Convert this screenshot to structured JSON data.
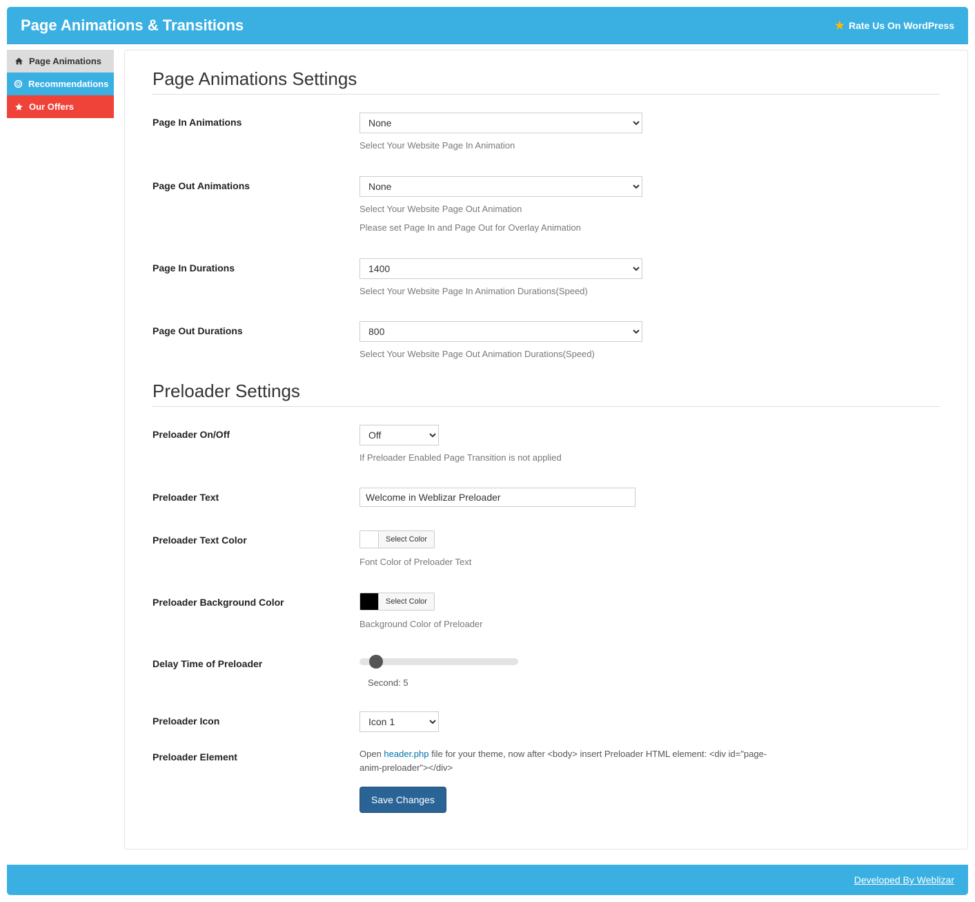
{
  "header": {
    "title": "Page Animations & Transitions",
    "rate_us": "Rate Us On WordPress"
  },
  "sidebar": {
    "items": [
      {
        "label": "Page Animations"
      },
      {
        "label": "Recommendations"
      },
      {
        "label": "Our Offers"
      }
    ]
  },
  "sections": {
    "page_anim_title": "Page Animations Settings",
    "preloader_title": "Preloader Settings"
  },
  "fields": {
    "page_in_anim": {
      "label": "Page In Animations",
      "value": "None",
      "help": "Select Your Website Page In Animation"
    },
    "page_out_anim": {
      "label": "Page Out Animations",
      "value": "None",
      "help": "Select Your Website Page Out Animation",
      "help2": "Please set Page In and Page Out for Overlay Animation"
    },
    "page_in_dur": {
      "label": "Page In Durations",
      "value": "1400",
      "help": "Select Your Website Page In Animation Durations(Speed)"
    },
    "page_out_dur": {
      "label": "Page Out Durations",
      "value": "800",
      "help": "Select Your Website Page Out Animation Durations(Speed)"
    },
    "preloader_onoff": {
      "label": "Preloader On/Off",
      "value": "Off",
      "help": "If Preloader Enabled Page Transition is not applied"
    },
    "preloader_text": {
      "label": "Preloader Text",
      "value": "Welcome in Weblizar Preloader"
    },
    "preloader_text_color": {
      "label": "Preloader Text Color",
      "btn": "Select Color",
      "help": "Font Color of Preloader Text",
      "swatch": "#ffffff"
    },
    "preloader_bg_color": {
      "label": "Preloader Background Color",
      "btn": "Select Color",
      "help": "Background Color of Preloader",
      "swatch": "#000000"
    },
    "delay": {
      "label": "Delay Time of Preloader",
      "seconds_prefix": "Second: ",
      "seconds": "5"
    },
    "preloader_icon": {
      "label": "Preloader Icon",
      "value": "Icon 1"
    },
    "preloader_element": {
      "label": "Preloader Element",
      "pre": "Open ",
      "link": "header.php",
      "post": " file for your theme, now after <body> insert Preloader HTML element: <div id=\"page-anim-preloader\"></div>"
    }
  },
  "buttons": {
    "save": "Save Changes"
  },
  "footer": {
    "credit": "Developed By Weblizar"
  }
}
